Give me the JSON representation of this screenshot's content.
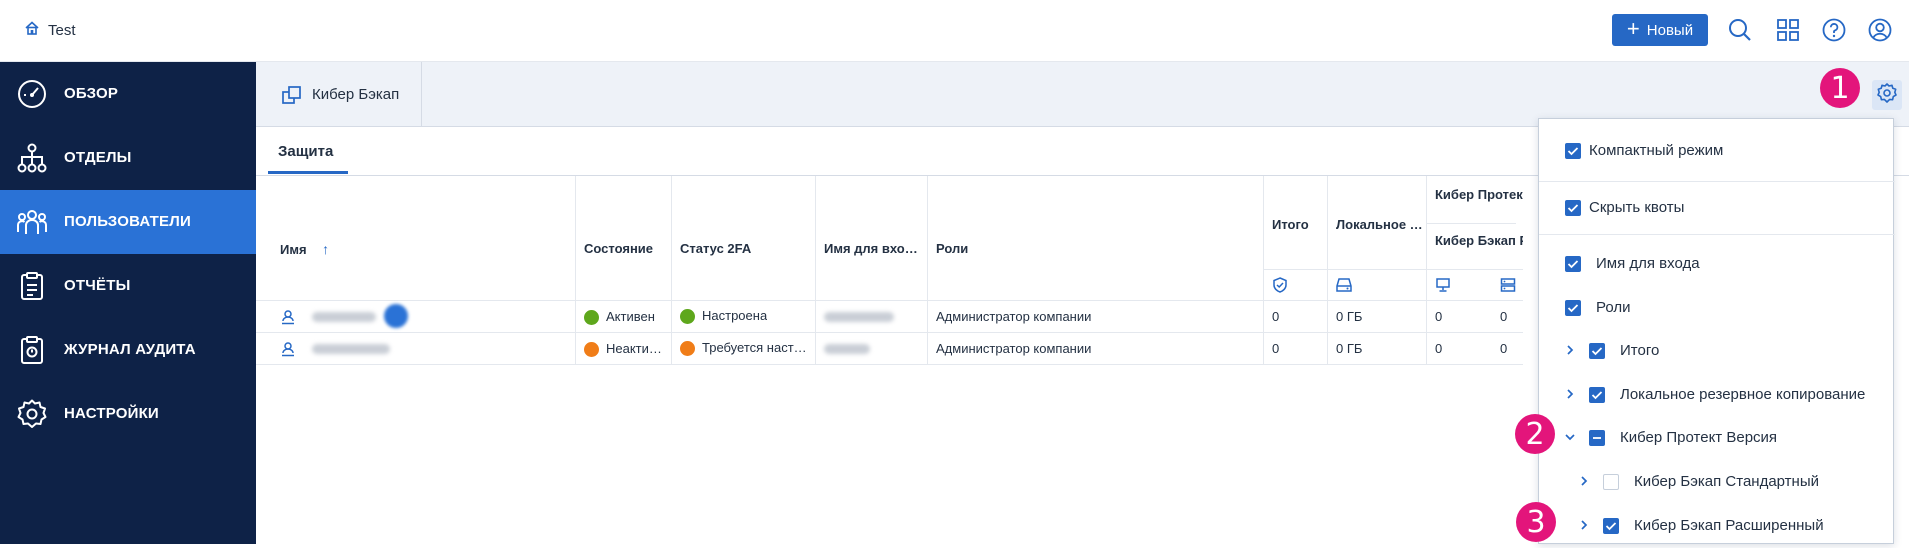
{
  "topbar": {
    "brand": "Test",
    "new_button": "Новый",
    "icons": [
      "home-icon",
      "search-icon",
      "apps-grid-icon",
      "help-icon",
      "account-icon"
    ]
  },
  "sidebar": {
    "items": [
      {
        "label": "ОБЗОР",
        "icon": "dashboard-gauge-icon"
      },
      {
        "label": "ОТДЕЛЫ",
        "icon": "org-tree-icon"
      },
      {
        "label": "ПОЛЬЗОВАТЕЛИ",
        "icon": "users-icon",
        "active": true
      },
      {
        "label": "ОТЧЁТЫ",
        "icon": "clipboard-icon"
      },
      {
        "label": "ЖУРНАЛ АУДИТА",
        "icon": "audit-clipboard-icon"
      },
      {
        "label": "НАСТРОЙКИ",
        "icon": "gear-icon"
      }
    ]
  },
  "service_tab": {
    "label": "Кибер Бэкап",
    "icon": "backup-squares-icon"
  },
  "sub_tab": {
    "label": "Защита"
  },
  "table": {
    "headers": {
      "name": "Имя",
      "state": "Состояние",
      "twofa": "Статус 2FA",
      "login": "Имя для вхо…",
      "roles": "Роли",
      "total": "Итого",
      "local": "Локальное …",
      "group": "Кибер Протект Ве",
      "group_sub": "Кибер Бэкап Расш"
    },
    "rows": [
      {
        "state": "Активен",
        "state_kind": "ok",
        "twofa": "Настроена",
        "twofa_kind": "ok",
        "roles": "Администратор компании",
        "total": "0",
        "local": "0 ГБ",
        "c1": "0",
        "c2": "0"
      },
      {
        "state": "Неакти…",
        "state_kind": "warn",
        "twofa": "Требуется наст…",
        "twofa_kind": "warn",
        "roles": "Администратор компании",
        "total": "0",
        "local": "0 ГБ",
        "c1": "0",
        "c2": "0"
      }
    ]
  },
  "callouts": {
    "one": "1",
    "two": "2",
    "three": "3"
  },
  "dropdown": {
    "compact": "Компактный режим",
    "hide_quotas": "Скрыть квоты",
    "login": "Имя для входа",
    "roles": "Роли",
    "total": "Итого",
    "local_backup": "Локальное резервное копирование",
    "protect_version": "Кибер Протект Версия",
    "backup_standard": "Кибер Бэкап Стандартный",
    "backup_extended": "Кибер Бэкап Расширенный"
  },
  "colors": {
    "accent": "#2668c5",
    "sidebar": "#0e2247",
    "active": "#2a72d6",
    "callout": "#e3157b",
    "ok": "#5ea71c",
    "warn": "#f07d18"
  }
}
